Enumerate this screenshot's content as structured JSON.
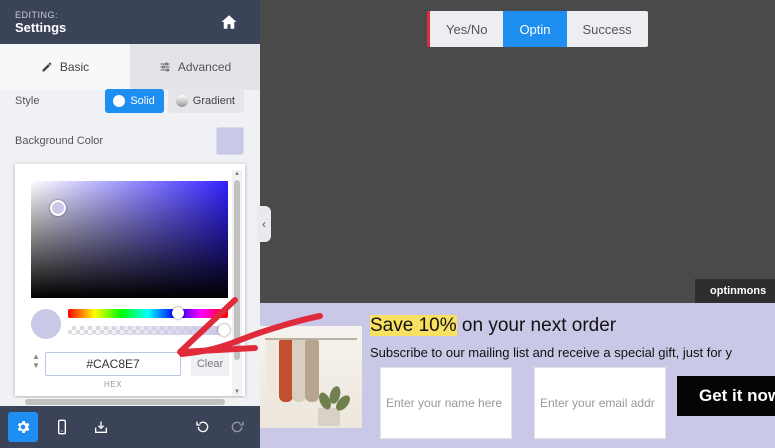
{
  "panel": {
    "editing_label": "EDITING:",
    "title": "Settings",
    "tabs": [
      {
        "label": "Basic",
        "icon": "pencil-icon",
        "active": true
      },
      {
        "label": "Advanced",
        "icon": "sliders-icon",
        "active": false
      }
    ],
    "style": {
      "label": "Style",
      "options": [
        {
          "label": "Solid",
          "active": true
        },
        {
          "label": "Gradient",
          "active": false
        }
      ]
    },
    "background_color": {
      "label": "Background Color",
      "value": "#CAC8E7"
    },
    "color_picker": {
      "hex_value": "#CAC8E7",
      "hex_label": "HEX",
      "clear_label": "Clear",
      "hue_fraction": 0.69,
      "alpha_fraction": 1.0
    },
    "footer": {
      "buttons": [
        "gear-icon",
        "mobile-icon",
        "download-icon"
      ],
      "actions": [
        "undo-icon",
        "redo-icon"
      ]
    }
  },
  "canvas": {
    "view_tabs": [
      {
        "label": "Yes/No",
        "active": false
      },
      {
        "label": "Optin",
        "active": true
      },
      {
        "label": "Success",
        "active": false
      }
    ],
    "brand_label": "optinmons",
    "optin": {
      "headline_highlight": "Save 10%",
      "headline_rest": " on your next order",
      "subtext": "Subscribe to our mailing list and receive a special gift, just for y",
      "name_placeholder": "Enter your name here",
      "email_placeholder": "Enter your email addr",
      "button_label": "Get it now"
    }
  },
  "colors": {
    "panel_dark": "#3b4358",
    "accent_blue": "#1f8ef1",
    "optin_background": "#CAC8E7",
    "highlight_yellow": "#f8e061",
    "annotation_red": "#e02b3b"
  }
}
